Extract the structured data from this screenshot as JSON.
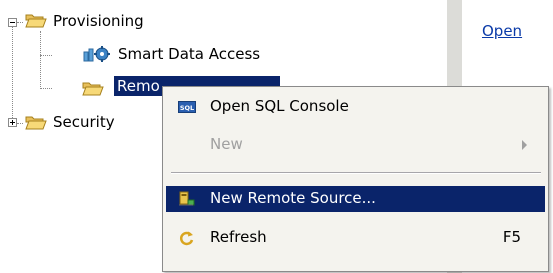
{
  "tree": {
    "nodes": [
      {
        "label": "Provisioning",
        "expanded": true
      },
      {
        "label": "Smart Data Access"
      },
      {
        "label": "Remo",
        "selected": true
      },
      {
        "label": "Security",
        "expanded": false
      }
    ]
  },
  "right_pane": {
    "link": "Open"
  },
  "context_menu": {
    "items": [
      {
        "label": "Open SQL Console",
        "icon": "sql-icon",
        "enabled": true
      },
      {
        "label": "New",
        "icon": "",
        "enabled": false,
        "submenu": true
      },
      {
        "label": "New Remote Source...",
        "icon": "remote-source-icon",
        "enabled": true,
        "highlighted": true
      },
      {
        "label": "Refresh",
        "icon": "refresh-icon",
        "enabled": true,
        "shortcut": "F5"
      }
    ]
  },
  "colors": {
    "selection": "#0a246a",
    "link": "#0a3aa8",
    "menu_bg": "#f4f3ee"
  }
}
